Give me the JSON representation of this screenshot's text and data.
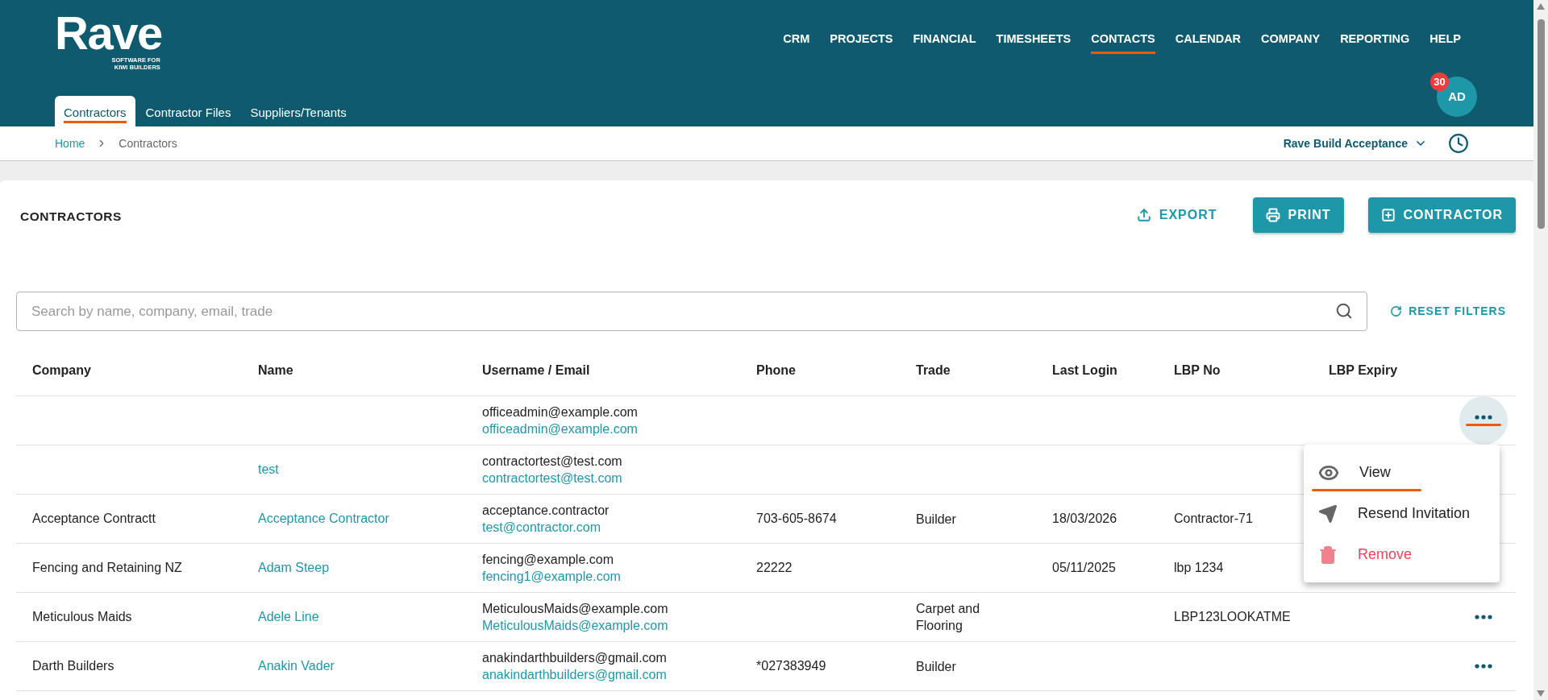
{
  "logo": {
    "name": "Rave",
    "tagline": [
      "SOFTWARE FOR",
      "KIWI BUILDERS"
    ]
  },
  "nav": [
    {
      "label": "CRM",
      "selected": false
    },
    {
      "label": "PROJECTS",
      "selected": false
    },
    {
      "label": "FINANCIAL",
      "selected": false
    },
    {
      "label": "TIMESHEETS",
      "selected": false
    },
    {
      "label": "CONTACTS",
      "selected": true
    },
    {
      "label": "CALENDAR",
      "selected": false
    },
    {
      "label": "COMPANY",
      "selected": false
    },
    {
      "label": "REPORTING",
      "selected": false
    },
    {
      "label": "HELP",
      "selected": false
    }
  ],
  "subtabs": [
    {
      "label": "Contractors",
      "selected": true
    },
    {
      "label": "Contractor Files",
      "selected": false
    },
    {
      "label": "Suppliers/Tenants",
      "selected": false
    }
  ],
  "user": {
    "initials": "AD",
    "badge": "30"
  },
  "breadcrumb": [
    "Home",
    "Contractors"
  ],
  "workspace": "Rave Build Acceptance",
  "page_title": "CONTRACTORS",
  "actions": [
    {
      "label": "EXPORT",
      "kind": "export"
    },
    {
      "label": "PRINT",
      "kind": "print"
    },
    {
      "label": "CONTRACTOR",
      "kind": "add"
    }
  ],
  "search": {
    "placeholder": "Search by name, company, email, trade"
  },
  "reset_filters": "RESET FILTERS",
  "table": {
    "columns": [
      "Company",
      "Name",
      "Username / Email",
      "Phone",
      "Trade",
      "Last Login",
      "LBP No",
      "LBP Expiry"
    ],
    "rows": [
      {
        "username": "officeadmin@example.com",
        "email": "officeadmin@example.com",
        "menu_button": {
          "active": true
        }
      },
      {
        "name": "test",
        "username": "contractortest@test.com",
        "email": "contractortest@test.com"
      },
      {
        "company": "Acceptance Contractt",
        "name": "Acceptance Contractor",
        "username": "acceptance.contractor",
        "email": "test@contractor.com",
        "phone": "703-605-8674",
        "trade": "Builder",
        "last_login": "18/03/2026",
        "lbp_no": "Contractor-71"
      },
      {
        "company": "Fencing and Retaining NZ",
        "name": "Adam Steep",
        "username": "fencing@example.com",
        "email": "fencing1@example.com",
        "phone": "22222",
        "last_login": "05/11/2025",
        "lbp_no": "lbp 1234"
      },
      {
        "company": "Meticulous Maids",
        "name": "Adele Line",
        "username": "MeticulousMaids@example.com",
        "email": "MeticulousMaids@example.com",
        "trade": "Carpet and Flooring",
        "lbp_no": "LBP123LOOKATME",
        "menu_button": {
          "active": false
        }
      },
      {
        "company": "Darth Builders",
        "name": "Anakin Vader",
        "username": "anakindarthbuilders@gmail.com",
        "email": "anakindarthbuilders@gmail.com",
        "phone": "*027383949",
        "trade": "Builder",
        "menu_button": {
          "active": false
        }
      }
    ]
  },
  "row_menu": {
    "items": [
      {
        "label": "View",
        "kind": "view",
        "selected": true
      },
      {
        "label": "Resend Invitation",
        "kind": "resend",
        "selected": false
      },
      {
        "label": "Remove",
        "kind": "remove",
        "selected": false
      }
    ]
  }
}
